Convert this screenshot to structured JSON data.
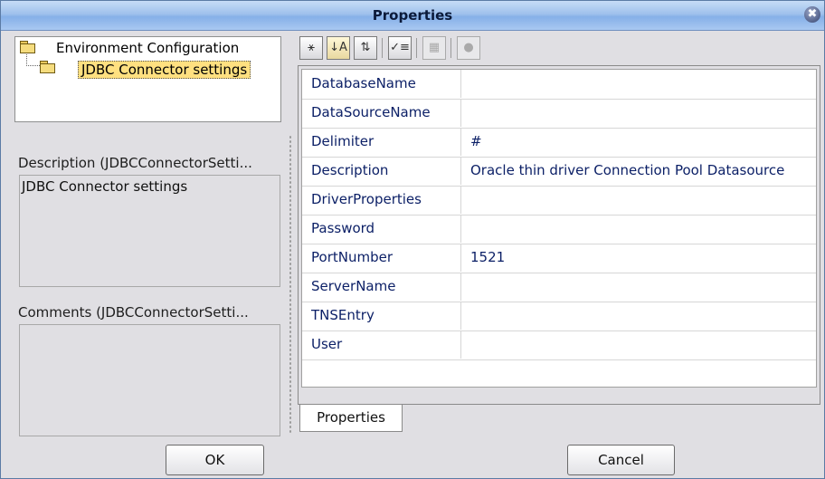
{
  "window": {
    "title": "Properties",
    "close_glyph": "✖"
  },
  "tree": {
    "root_label": "Environment Configuration",
    "child_label": "JDBC Connector settings"
  },
  "description": {
    "label": "Description (JDBCConnectorSetti...",
    "text": "JDBC Connector settings"
  },
  "comments": {
    "label": "Comments (JDBCConnectorSetti...",
    "text": ""
  },
  "toolbar": {
    "buttons": [
      {
        "icon": "categorized-icon",
        "glyph": "⚹"
      },
      {
        "icon": "sort-alphabetical-icon",
        "glyph": "↓A"
      },
      {
        "icon": "sort-by-type-icon",
        "glyph": "⇅"
      },
      {
        "icon": "show-editable-icon",
        "glyph": "✓≡"
      },
      {
        "icon": "custom-editor-icon",
        "glyph": "▦"
      },
      {
        "icon": "help-icon",
        "glyph": "●"
      }
    ]
  },
  "properties": [
    {
      "name": "DatabaseName",
      "value": ""
    },
    {
      "name": "DataSourceName",
      "value": ""
    },
    {
      "name": "Delimiter",
      "value": "#"
    },
    {
      "name": "Description",
      "value": "Oracle thin driver Connection Pool Datasource"
    },
    {
      "name": "DriverProperties",
      "value": ""
    },
    {
      "name": "Password",
      "value": ""
    },
    {
      "name": "PortNumber",
      "value": "1521"
    },
    {
      "name": "ServerName",
      "value": ""
    },
    {
      "name": "TNSEntry",
      "value": ""
    },
    {
      "name": "User",
      "value": ""
    }
  ],
  "tab": {
    "label": "Properties"
  },
  "buttons": {
    "ok": "OK",
    "cancel": "Cancel"
  },
  "colors": {
    "selection_highlight": "#ffe080",
    "property_text": "#0b1f66",
    "titlebar": "#9fc1ec"
  }
}
